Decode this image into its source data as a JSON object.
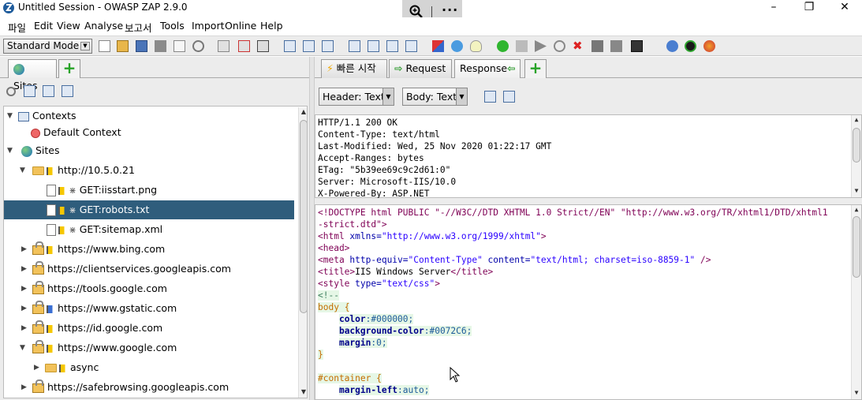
{
  "window": {
    "title": "Untitled Session - OWASP ZAP 2.9.0"
  },
  "menu": [
    "파일",
    "Edit",
    "View",
    "Analyse",
    "보고서",
    "Tools",
    "Import",
    "Online",
    "Help"
  ],
  "toolbar": {
    "mode": "Standard Mode"
  },
  "left_tabs": [
    {
      "label": "Sites"
    }
  ],
  "tree": [
    {
      "label": "Contexts",
      "level": 0,
      "expanded": true
    },
    {
      "label": "Default Context",
      "level": 1
    },
    {
      "label": "Sites",
      "level": 0,
      "expanded": true
    },
    {
      "label": "http://10.5.0.21",
      "level": 1,
      "expanded": true
    },
    {
      "label": "GET:iisstart.png",
      "level": 2
    },
    {
      "label": "GET:robots.txt",
      "level": 2,
      "selected": true
    },
    {
      "label": "GET:sitemap.xml",
      "level": 2
    },
    {
      "label": "https://www.bing.com",
      "level": 1
    },
    {
      "label": "https://clientservices.googleapis.com",
      "level": 1
    },
    {
      "label": "https://tools.google.com",
      "level": 1
    },
    {
      "label": "https://www.gstatic.com",
      "level": 1
    },
    {
      "label": "https://id.google.com",
      "level": 1
    },
    {
      "label": "https://www.google.com",
      "level": 1,
      "expanded": true
    },
    {
      "label": "async",
      "level": 2
    },
    {
      "label": "https://safebrowsing.googleapis.com",
      "level": 1
    }
  ],
  "right_tabs": [
    {
      "label": "빠른 시작"
    },
    {
      "label": "Request"
    },
    {
      "label": "Response"
    }
  ],
  "view": {
    "header_format": "Header: Text",
    "body_format": "Body: Text"
  },
  "response_header": [
    "HTTP/1.1 200 OK",
    "Content-Type: text/html",
    "Last-Modified: Wed, 25 Nov 2020 01:22:17 GMT",
    "Accept-Ranges: bytes",
    "ETag: \"5b39ee69c9c2d61:0\"",
    "Server: Microsoft-IIS/10.0",
    "X-Powered-By: ASP.NET"
  ],
  "body": {
    "doctype_1": "<!DOCTYPE html PUBLIC \"-//W3C//DTD XHTML 1.0 Strict//EN\" \"http://www.w3.org/TR/xhtml1/DTD/xhtml1",
    "doctype_2": "-strict.dtd\">",
    "html_open": "<html",
    "html_attr": " xmlns=",
    "html_val": "\"http://www.w3.org/1999/xhtml\"",
    "html_close": ">",
    "head": "<head>",
    "meta_open": "<meta",
    "meta_a1": " http-equiv=",
    "meta_v1": "\"Content-Type\"",
    "meta_a2": " content=",
    "meta_v2": "\"text/html; charset=iso-8859-1\"",
    "meta_close": " />",
    "title_open": "<title>",
    "title_text": "IIS Windows Server",
    "title_close": "</title>",
    "style_open": "<style",
    "style_attr": " type=",
    "style_val": "\"text/css\"",
    "style_close": ">",
    "comment": "<!--",
    "sel_body": "body",
    "brace_open": " {",
    "p_color": "color",
    "v_color": ":#000000;",
    "p_bg": "background-color",
    "v_bg": ":#0072C6;",
    "p_margin": "margin",
    "v_margin": ":0;",
    "brace_close": "}",
    "sel_container": "#container",
    "p_ml": "margin-left",
    "v_ml": ":auto;"
  }
}
